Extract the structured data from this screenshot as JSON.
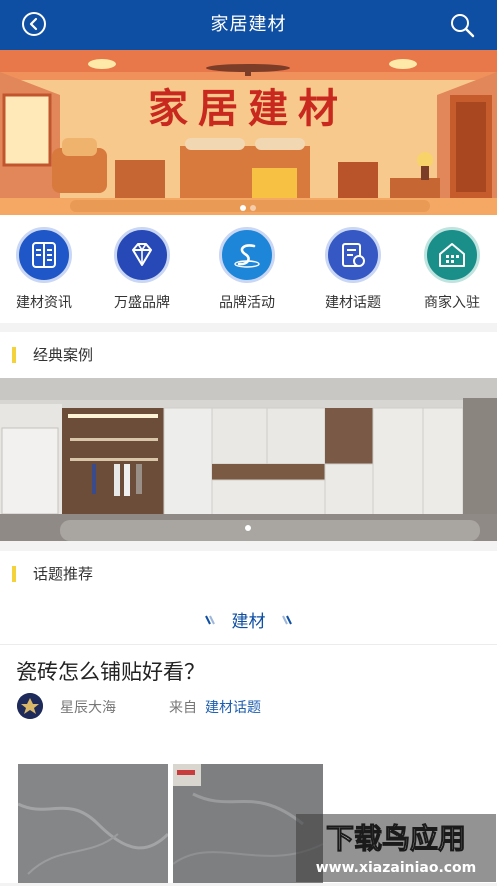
{
  "header": {
    "title": "家居建材",
    "back_icon": "back-circle-icon",
    "search_icon": "search-icon",
    "bg": "#0f4fa3"
  },
  "banner": {
    "title": "家居建材"
  },
  "categories": [
    {
      "label": "建材资讯",
      "icon": "news-book-icon"
    },
    {
      "label": "万盛品牌",
      "icon": "diamond-icon"
    },
    {
      "label": "品牌活动",
      "icon": "brand-s-icon"
    },
    {
      "label": "建材话题",
      "icon": "topic-doc-icon"
    },
    {
      "label": "商家入驻",
      "icon": "house-icon"
    }
  ],
  "sections": {
    "cases": "经典案例",
    "topics": "话题推荐"
  },
  "topic_tag": "建材",
  "post": {
    "title": "瓷砖怎么铺贴好看？",
    "author": "星辰大海",
    "from_label": "来自",
    "from_link": "建材话题"
  },
  "watermark": {
    "line1": "下载鸟应用",
    "line2": "www.xiazainiao.com"
  }
}
